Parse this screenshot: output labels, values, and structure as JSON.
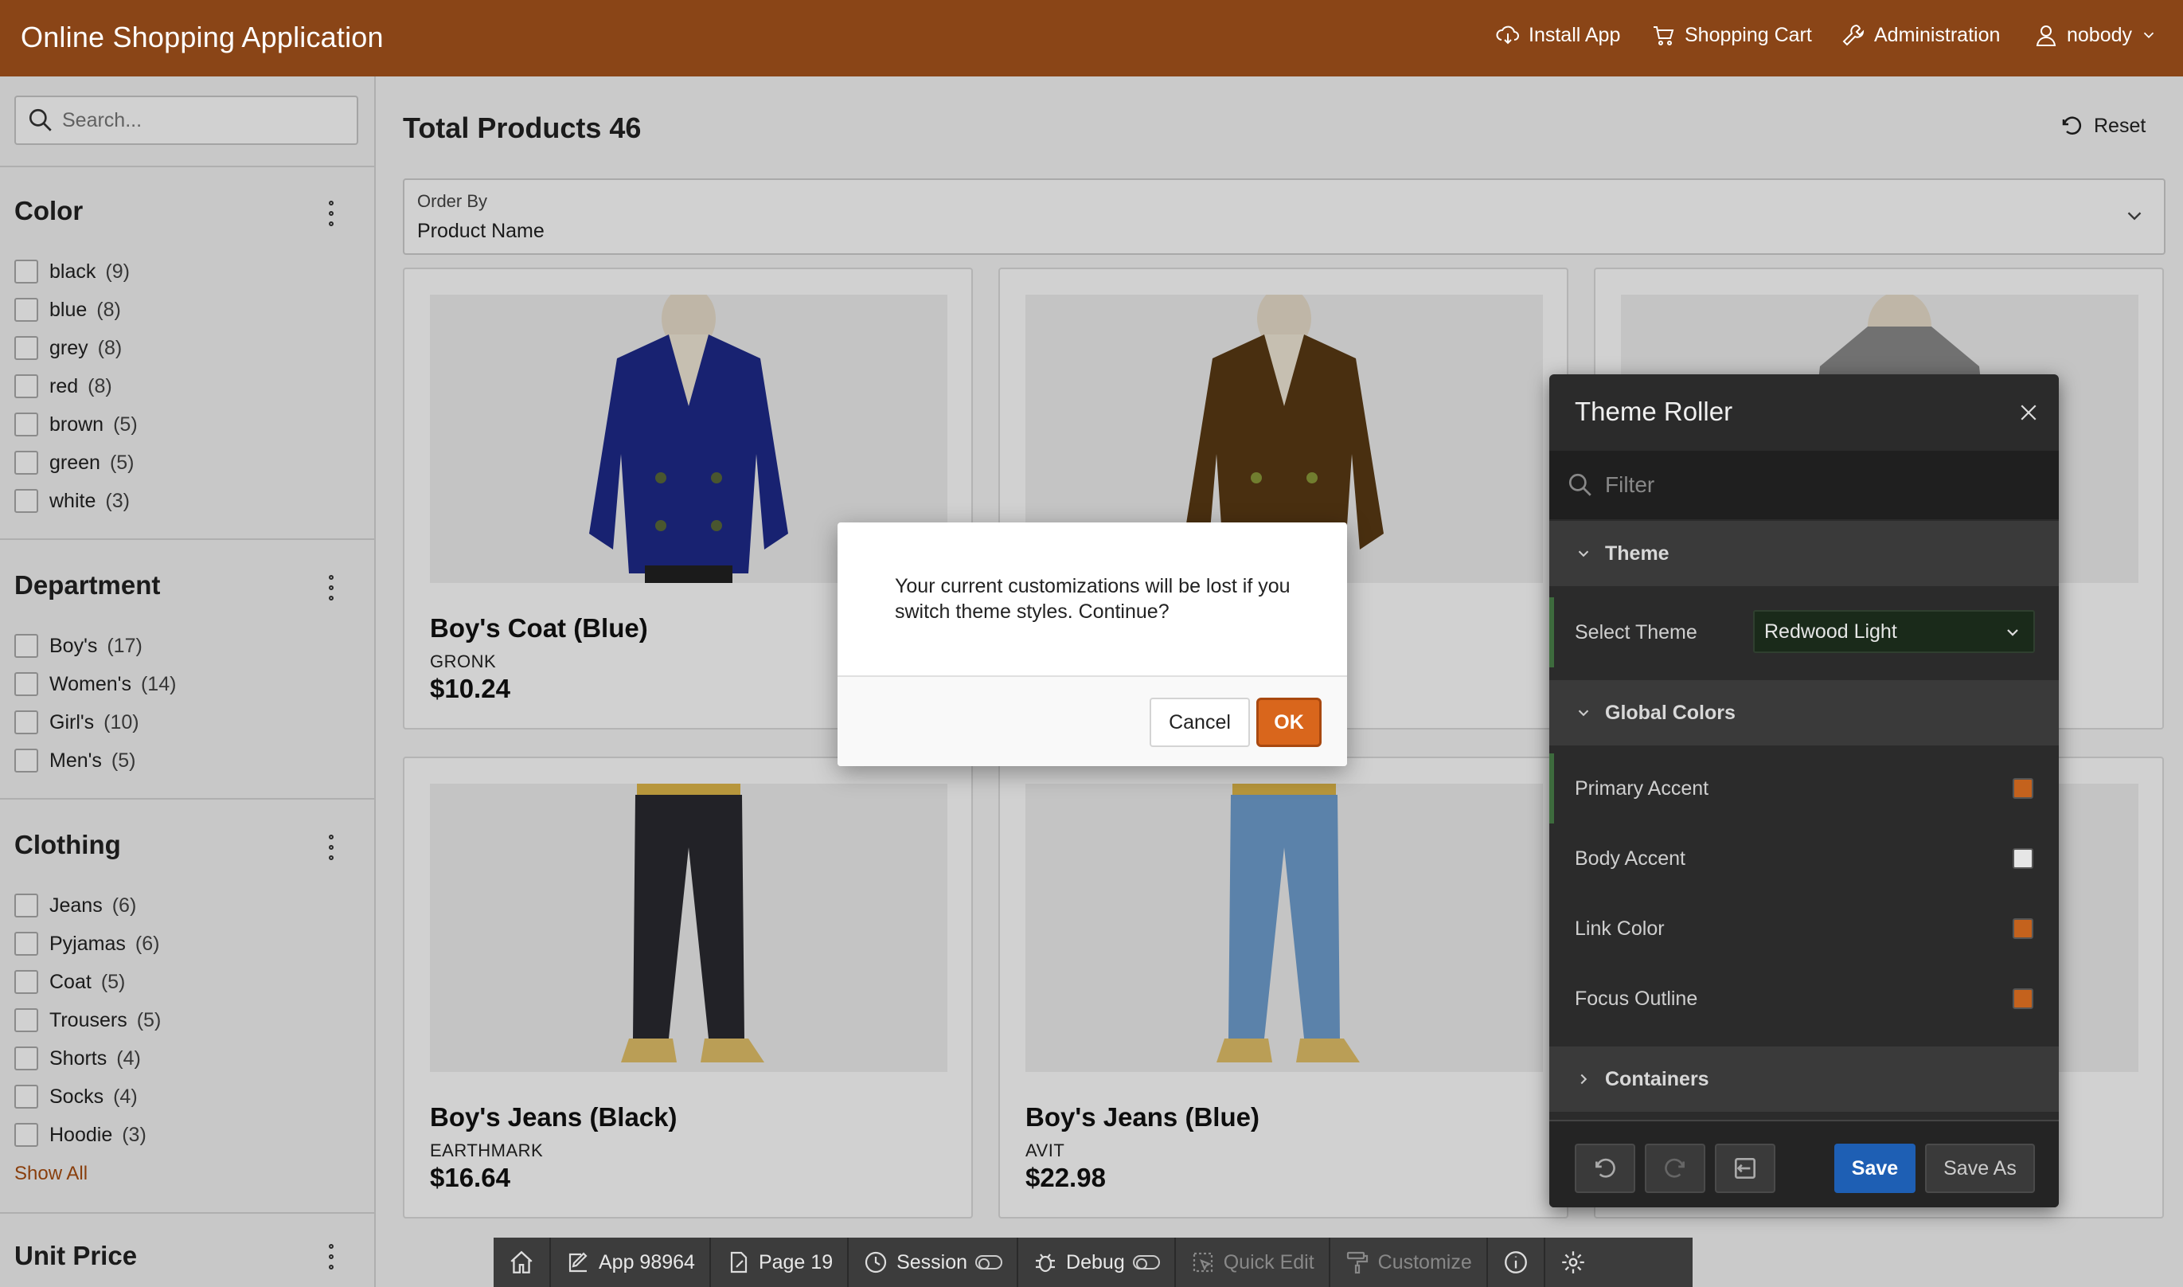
{
  "header": {
    "app_title": "Online Shopping Application",
    "install_app": "Install App",
    "shopping_cart": "Shopping Cart",
    "administration": "Administration",
    "user": "nobody"
  },
  "sidebar": {
    "search_placeholder": "Search...",
    "facets": [
      {
        "title": "Color",
        "options": [
          {
            "label": "black",
            "count": "(9)"
          },
          {
            "label": "blue",
            "count": "(8)"
          },
          {
            "label": "grey",
            "count": "(8)"
          },
          {
            "label": "red",
            "count": "(8)"
          },
          {
            "label": "brown",
            "count": "(5)"
          },
          {
            "label": "green",
            "count": "(5)"
          },
          {
            "label": "white",
            "count": "(3)"
          }
        ]
      },
      {
        "title": "Department",
        "options": [
          {
            "label": "Boy's",
            "count": "(17)"
          },
          {
            "label": "Women's",
            "count": "(14)"
          },
          {
            "label": "Girl's",
            "count": "(10)"
          },
          {
            "label": "Men's",
            "count": "(5)"
          }
        ]
      },
      {
        "title": "Clothing",
        "options": [
          {
            "label": "Jeans",
            "count": "(6)"
          },
          {
            "label": "Pyjamas",
            "count": "(6)"
          },
          {
            "label": "Coat",
            "count": "(5)"
          },
          {
            "label": "Trousers",
            "count": "(5)"
          },
          {
            "label": "Shorts",
            "count": "(4)"
          },
          {
            "label": "Socks",
            "count": "(4)"
          },
          {
            "label": "Hoodie",
            "count": "(3)"
          }
        ]
      },
      {
        "title": "Unit Price",
        "options": []
      }
    ],
    "show_all": "Show All"
  },
  "main": {
    "total_products": "Total Products 46",
    "reset": "Reset",
    "order_by_label": "Order By",
    "order_by_value": "Product Name",
    "products": [
      {
        "name": "Boy's Coat (Blue)",
        "brand": "GRONK",
        "price": "$10.24"
      },
      {
        "name": "Boy's Jeans (Black)",
        "brand": "EARTHMARK",
        "price": "$16.64"
      },
      {
        "name": "Boy's Jeans (Blue)",
        "brand": "AVIT",
        "price": "$22.98"
      }
    ]
  },
  "dialog": {
    "message": "Your current customizations will be lost if you switch theme styles. Continue?",
    "cancel": "Cancel",
    "ok": "OK"
  },
  "theme_roller": {
    "title": "Theme Roller",
    "filter_placeholder": "Filter",
    "section_theme": "Theme",
    "select_theme_label": "Select Theme",
    "select_theme_value": "Redwood Light",
    "section_global_colors": "Global Colors",
    "colors": [
      {
        "label": "Primary Accent",
        "color": "#c4621d"
      },
      {
        "label": "Body Accent",
        "color": "#e6e6e6"
      },
      {
        "label": "Link Color",
        "color": "#c4621d"
      },
      {
        "label": "Focus Outline",
        "color": "#c4621d"
      }
    ],
    "section_containers": "Containers",
    "save": "Save",
    "save_as": "Save As"
  },
  "devbar": {
    "app": "App 98964",
    "page": "Page 19",
    "session": "Session",
    "debug": "Debug",
    "quick_edit": "Quick Edit",
    "customize": "Customize"
  },
  "colors": {
    "header_bg": "#8a4517",
    "accent": "#d9661c",
    "save_blue": "#1e5fb4"
  }
}
